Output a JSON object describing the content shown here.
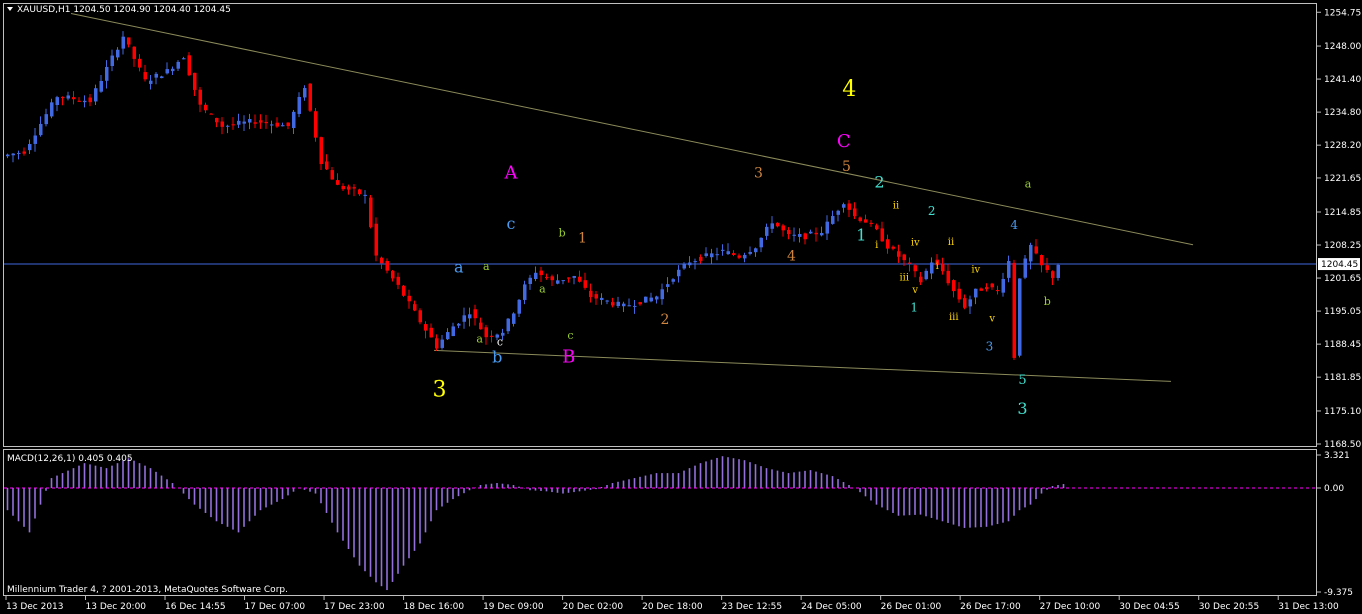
{
  "header": {
    "title": "XAUUSD,H1  1204.50 1204.90 1204.40 1204.45"
  },
  "macd_header": "MACD(12,26,1) 0.405 0.405",
  "footer": "Millennium Trader 4, ? 2001-2013, MetaQuotes Software Corp.",
  "colors": {
    "background": "#000000",
    "bull": "#4169e1",
    "bear": "#ff0000",
    "macd": "#9370db",
    "axis": "#ffffff",
    "trendline": "#8b8b5a",
    "current_price_line": "#4169e1"
  },
  "price_axis": {
    "ticks": [
      "1254.75",
      "1248.00",
      "1241.40",
      "1234.80",
      "1228.20",
      "1221.65",
      "1214.85",
      "1208.25",
      "1201.65",
      "1195.05",
      "1188.45",
      "1181.85",
      "1175.10",
      "1168.50"
    ],
    "current": "1204.45"
  },
  "macd_axis": {
    "ticks": [
      "3.321",
      "0.00",
      "-9.375"
    ]
  },
  "time_axis": {
    "labels": [
      "13 Dec 2013",
      "13 Dec 20:00",
      "16 Dec 14:55",
      "17 Dec 07:00",
      "17 Dec 23:00",
      "18 Dec 16:00",
      "19 Dec 09:00",
      "20 Dec 02:00",
      "20 Dec 18:00",
      "23 Dec 12:55",
      "24 Dec 05:00",
      "26 Dec 01:00",
      "26 Dec 17:00",
      "27 Dec 10:00",
      "30 Dec 04:55",
      "30 Dec 20:55",
      "31 Dec 13:00"
    ]
  },
  "chart_data": {
    "type": "line",
    "symbol": "XAUUSD",
    "timeframe": "H1",
    "ylim": [
      1168.5,
      1256.0
    ],
    "price_path": [
      [
        0,
        1226
      ],
      [
        4,
        1227
      ],
      [
        10,
        1238
      ],
      [
        16,
        1237
      ],
      [
        22,
        1250
      ],
      [
        26,
        1241
      ],
      [
        30,
        1243
      ],
      [
        33,
        1246
      ],
      [
        36,
        1236
      ],
      [
        40,
        1232
      ],
      [
        46,
        1233
      ],
      [
        52,
        1232
      ],
      [
        55,
        1240
      ],
      [
        58,
        1225
      ],
      [
        61,
        1220
      ],
      [
        64,
        1219
      ],
      [
        66,
        1218
      ],
      [
        68,
        1206
      ],
      [
        72,
        1200
      ],
      [
        76,
        1193
      ],
      [
        79,
        1188
      ],
      [
        82,
        1192
      ],
      [
        85,
        1195
      ],
      [
        88,
        1190
      ],
      [
        91,
        1191
      ],
      [
        93,
        1195
      ],
      [
        95,
        1200
      ],
      [
        97,
        1203
      ],
      [
        100,
        1201
      ],
      [
        104,
        1202
      ],
      [
        107,
        1198
      ],
      [
        110,
        1197
      ],
      [
        113,
        1196
      ],
      [
        116,
        1197
      ],
      [
        119,
        1198
      ],
      [
        122,
        1202
      ],
      [
        125,
        1205
      ],
      [
        128,
        1206
      ],
      [
        131,
        1207
      ],
      [
        134,
        1206
      ],
      [
        137,
        1208
      ],
      [
        140,
        1213
      ],
      [
        143,
        1210
      ],
      [
        146,
        1210
      ],
      [
        149,
        1211
      ],
      [
        151,
        1214
      ],
      [
        153,
        1217
      ],
      [
        155,
        1214
      ],
      [
        157,
        1213
      ],
      [
        159,
        1211
      ],
      [
        161,
        1208
      ],
      [
        163,
        1206
      ],
      [
        165,
        1204
      ],
      [
        167,
        1201
      ],
      [
        169,
        1205
      ],
      [
        171,
        1203
      ],
      [
        173,
        1199
      ],
      [
        175,
        1196
      ],
      [
        177,
        1199
      ],
      [
        179,
        1200
      ],
      [
        181,
        1199
      ],
      [
        183,
        1205
      ],
      [
        184,
        1186
      ],
      [
        185,
        1202
      ],
      [
        187,
        1208
      ],
      [
        189,
        1204
      ],
      [
        191,
        1202
      ],
      [
        192,
        1204.45
      ]
    ],
    "macd_path": [
      [
        0,
        -2
      ],
      [
        4,
        -4
      ],
      [
        8,
        1
      ],
      [
        14,
        2.5
      ],
      [
        18,
        2
      ],
      [
        22,
        3
      ],
      [
        26,
        2
      ],
      [
        30,
        0.5
      ],
      [
        34,
        -1.5
      ],
      [
        38,
        -3
      ],
      [
        42,
        -4
      ],
      [
        46,
        -2
      ],
      [
        50,
        -1
      ],
      [
        53,
        0
      ],
      [
        56,
        -0.5
      ],
      [
        60,
        -4
      ],
      [
        64,
        -7
      ],
      [
        67,
        -8.5
      ],
      [
        69,
        -9.2
      ],
      [
        72,
        -7
      ],
      [
        75,
        -5
      ],
      [
        78,
        -2
      ],
      [
        81,
        -1
      ],
      [
        84,
        -0.2
      ],
      [
        86,
        0.3
      ],
      [
        89,
        0.5
      ],
      [
        92,
        0.3
      ],
      [
        95,
        -0.2
      ],
      [
        98,
        -0.3
      ],
      [
        101,
        -0.5
      ],
      [
        104,
        -0.3
      ],
      [
        107,
        -0.1
      ],
      [
        110,
        0.5
      ],
      [
        114,
        1
      ],
      [
        118,
        1.5
      ],
      [
        122,
        1.5
      ],
      [
        126,
        2.5
      ],
      [
        130,
        3.2
      ],
      [
        134,
        2.8
      ],
      [
        138,
        2
      ],
      [
        142,
        1.5
      ],
      [
        146,
        1.8
      ],
      [
        150,
        1.2
      ],
      [
        154,
        0
      ],
      [
        158,
        -1.5
      ],
      [
        162,
        -2.5
      ],
      [
        166,
        -2.4
      ],
      [
        170,
        -3
      ],
      [
        174,
        -3.6
      ],
      [
        178,
        -3.5
      ],
      [
        182,
        -3
      ],
      [
        184,
        -2
      ],
      [
        186,
        -1.5
      ],
      [
        188,
        -0.5
      ],
      [
        190,
        0.2
      ],
      [
        192,
        0.4
      ]
    ],
    "trendlines": [
      {
        "from": [
          12,
          1254.5
        ],
        "to": [
          216,
          1208.3
        ]
      },
      {
        "from": [
          78,
          1187.2
        ],
        "to": [
          212,
          1181
        ]
      }
    ],
    "annotations": [
      {
        "text": "3",
        "x": 79,
        "y": 1178,
        "color": "#ffff00",
        "size": 22
      },
      {
        "text": "A",
        "x": 92,
        "y": 1221.5,
        "color": "#ff00ff",
        "size": 18
      },
      {
        "text": "B",
        "x": 102.5,
        "y": 1184.8,
        "color": "#ff00ff",
        "size": 18
      },
      {
        "text": "C",
        "x": 152.5,
        "y": 1227.8,
        "color": "#ff00ff",
        "size": 18
      },
      {
        "text": "4",
        "x": 153.5,
        "y": 1238,
        "color": "#ffff00",
        "size": 22
      },
      {
        "text": "a",
        "x": 82.5,
        "y": 1202.8,
        "color": "#4a9af0",
        "size": 16
      },
      {
        "text": "b",
        "x": 89.5,
        "y": 1184.8,
        "color": "#4a9af0",
        "size": 16
      },
      {
        "text": "c",
        "x": 92,
        "y": 1211.5,
        "color": "#4a9af0",
        "size": 16
      },
      {
        "text": "a",
        "x": 87.5,
        "y": 1203.3,
        "color": "#9acd32",
        "size": 11
      },
      {
        "text": "a",
        "x": 86.3,
        "y": 1188.8,
        "color": "#9acd32",
        "size": 11
      },
      {
        "text": "c",
        "x": 90,
        "y": 1188.2,
        "color": "#ffffff",
        "size": 11
      },
      {
        "text": "b",
        "x": 101.3,
        "y": 1210,
        "color": "#9acd32",
        "size": 11
      },
      {
        "text": "a",
        "x": 97.7,
        "y": 1198.8,
        "color": "#9acd32",
        "size": 11
      },
      {
        "text": "c",
        "x": 102.8,
        "y": 1189.5,
        "color": "#9acd32",
        "size": 11
      },
      {
        "text": "1",
        "x": 105,
        "y": 1208.8,
        "color": "#cd853f",
        "size": 14
      },
      {
        "text": "2",
        "x": 120,
        "y": 1192.5,
        "color": "#cd853f",
        "size": 14
      },
      {
        "text": "3",
        "x": 137,
        "y": 1221.7,
        "color": "#cd853f",
        "size": 14
      },
      {
        "text": "4",
        "x": 143,
        "y": 1205.2,
        "color": "#cd853f",
        "size": 14
      },
      {
        "text": "5",
        "x": 153,
        "y": 1223,
        "color": "#cd853f",
        "size": 14
      },
      {
        "text": "1",
        "x": 155.7,
        "y": 1209.2,
        "color": "#40e0d0",
        "size": 16
      },
      {
        "text": "2",
        "x": 159,
        "y": 1219.7,
        "color": "#40e0d0",
        "size": 16
      },
      {
        "text": "ii",
        "x": 162,
        "y": 1215.5,
        "color": "#ffd700",
        "size": 10
      },
      {
        "text": "i",
        "x": 158.5,
        "y": 1207.7,
        "color": "#ffd700",
        "size": 10
      },
      {
        "text": "iv",
        "x": 165.5,
        "y": 1208.2,
        "color": "#ffd700",
        "size": 10
      },
      {
        "text": "iii",
        "x": 163.5,
        "y": 1201.2,
        "color": "#ffd700",
        "size": 10
      },
      {
        "text": "v",
        "x": 165.5,
        "y": 1198.7,
        "color": "#ffd700",
        "size": 10
      },
      {
        "text": "1",
        "x": 165.3,
        "y": 1195,
        "color": "#40e0d0",
        "size": 12
      },
      {
        "text": "2",
        "x": 168.5,
        "y": 1214.2,
        "color": "#40e0d0",
        "size": 12
      },
      {
        "text": "i",
        "x": 169.5,
        "y": 1203.5,
        "color": "#ffd700",
        "size": 10
      },
      {
        "text": "ii",
        "x": 172,
        "y": 1208.3,
        "color": "#ffd700",
        "size": 10
      },
      {
        "text": "iv",
        "x": 176.5,
        "y": 1202.8,
        "color": "#ffd700",
        "size": 10
      },
      {
        "text": "iii",
        "x": 172.5,
        "y": 1193.3,
        "color": "#ffd700",
        "size": 10
      },
      {
        "text": "v",
        "x": 179.5,
        "y": 1193,
        "color": "#ffd700",
        "size": 10
      },
      {
        "text": "3",
        "x": 179,
        "y": 1187.2,
        "color": "#4a9af0",
        "size": 12
      },
      {
        "text": "4",
        "x": 183.5,
        "y": 1211.5,
        "color": "#4a9af0",
        "size": 12
      },
      {
        "text": "a",
        "x": 186,
        "y": 1219.7,
        "color": "#9acd32",
        "size": 11
      },
      {
        "text": "b",
        "x": 189.5,
        "y": 1196.3,
        "color": "#9acd32",
        "size": 11
      },
      {
        "text": "5",
        "x": 185,
        "y": 1180.5,
        "color": "#40e0d0",
        "size": 13
      },
      {
        "text": "3",
        "x": 185,
        "y": 1174.5,
        "color": "#40e0d0",
        "size": 16
      }
    ]
  }
}
